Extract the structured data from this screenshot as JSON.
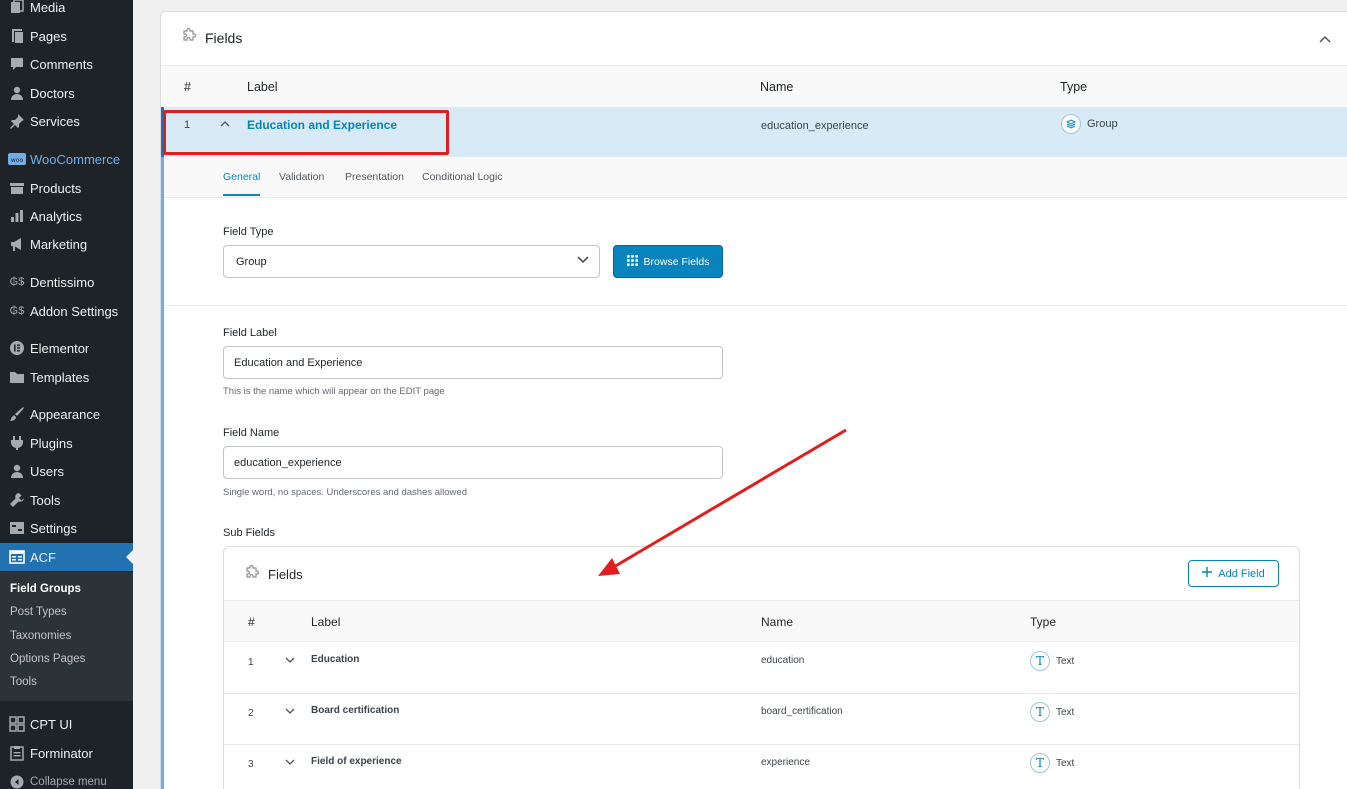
{
  "sidebar": {
    "items": [
      {
        "label": "Media",
        "icon": "media-icon"
      },
      {
        "label": "Pages",
        "icon": "pages-icon"
      },
      {
        "label": "Comments",
        "icon": "comments-icon"
      },
      {
        "label": "Doctors",
        "icon": "user-icon"
      },
      {
        "label": "Services",
        "icon": "pin-icon"
      },
      {
        "label": "WooCommerce",
        "icon": "woocommerce-icon"
      },
      {
        "label": "Products",
        "icon": "products-icon"
      },
      {
        "label": "Analytics",
        "icon": "analytics-icon"
      },
      {
        "label": "Marketing",
        "icon": "megaphone-icon"
      },
      {
        "label": "Dentissimo",
        "icon": "currency-icon"
      },
      {
        "label": "Addon Settings",
        "icon": "currency-icon"
      },
      {
        "label": "Elementor",
        "icon": "elementor-icon"
      },
      {
        "label": "Templates",
        "icon": "folder-icon"
      },
      {
        "label": "Appearance",
        "icon": "brush-icon"
      },
      {
        "label": "Plugins",
        "icon": "plugin-icon"
      },
      {
        "label": "Users",
        "icon": "user-icon"
      },
      {
        "label": "Tools",
        "icon": "wrench-icon"
      },
      {
        "label": "Settings",
        "icon": "settings-icon"
      },
      {
        "label": "ACF",
        "icon": "acf-icon"
      }
    ],
    "submenu": [
      "Field Groups",
      "Post Types",
      "Taxonomies",
      "Options Pages",
      "Tools"
    ],
    "after": [
      {
        "label": "CPT UI",
        "icon": "grid-icon"
      },
      {
        "label": "Forminator",
        "icon": "clipboard-icon"
      }
    ],
    "collapse_label": "Collapse menu"
  },
  "panel": {
    "title": "Fields",
    "columns": {
      "num": "#",
      "label": "Label",
      "name": "Name",
      "type": "Type"
    },
    "row": {
      "num": "1",
      "label": "Education and Experience",
      "name": "education_experience",
      "type": "Group"
    },
    "tabs": [
      "General",
      "Validation",
      "Presentation",
      "Conditional Logic"
    ],
    "field_type": {
      "label": "Field Type",
      "value": "Group",
      "browse_label": "Browse Fields"
    },
    "field_label": {
      "label": "Field Label",
      "value": "Education and Experience",
      "help": "This is the name which will appear on the EDIT page"
    },
    "field_name": {
      "label": "Field Name",
      "value": "education_experience",
      "help": "Single word, no spaces. Underscores and dashes allowed"
    },
    "sub_fields": {
      "label": "Sub Fields",
      "title": "Fields",
      "add_label": "Add Field",
      "columns": {
        "num": "#",
        "label": "Label",
        "name": "Name",
        "type": "Type"
      },
      "rows": [
        {
          "num": "1",
          "label": "Education",
          "name": "education",
          "type": "Text"
        },
        {
          "num": "2",
          "label": "Board certification",
          "name": "board_certification",
          "type": "Text"
        },
        {
          "num": "3",
          "label": "Field of experience",
          "name": "experience",
          "type": "Text"
        }
      ]
    }
  },
  "colors": {
    "accent": "#0783be",
    "sidebar": "#1d2327",
    "active": "#2271b1",
    "annotation": "#e01e1e"
  }
}
